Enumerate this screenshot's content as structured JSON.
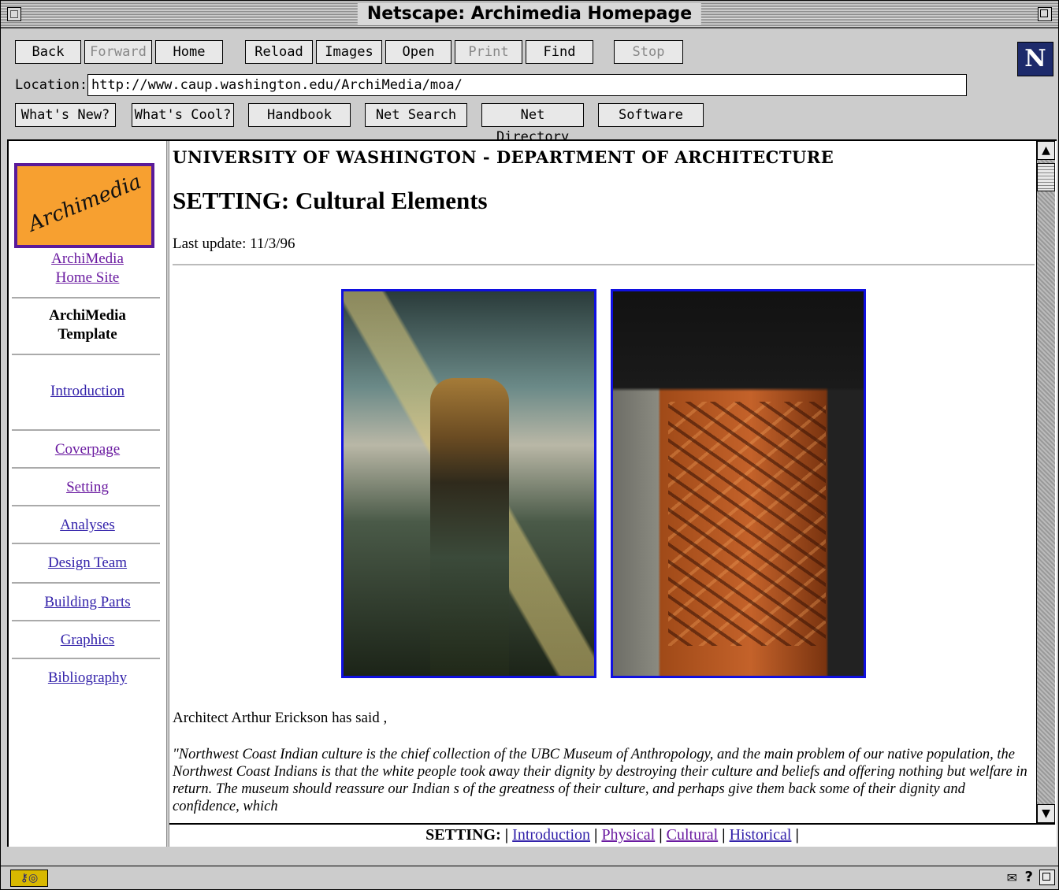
{
  "window": {
    "title": "Netscape: Archimedia Homepage"
  },
  "toolbar": {
    "buttons": [
      {
        "label": "Back",
        "enabled": true
      },
      {
        "label": "Forward",
        "enabled": false
      },
      {
        "label": "Home",
        "enabled": true
      },
      {
        "label": "Reload",
        "enabled": true
      },
      {
        "label": "Images",
        "enabled": true
      },
      {
        "label": "Open",
        "enabled": true
      },
      {
        "label": "Print",
        "enabled": false
      },
      {
        "label": "Find",
        "enabled": true
      },
      {
        "label": "Stop",
        "enabled": false
      }
    ],
    "logo_letter": "N"
  },
  "location": {
    "label": "Location:",
    "url": "http://www.caup.washington.edu/ArchiMedia/moa/"
  },
  "directory": {
    "buttons": [
      "What's New?",
      "What's Cool?",
      "Handbook",
      "Net Search",
      "Net Directory",
      "Software"
    ]
  },
  "sidebar": {
    "logo_text": "Archimedia",
    "home_link_line1": "ArchiMedia",
    "home_link_line2": "Home Site",
    "template_line1": "ArchiMedia",
    "template_line2": "Template",
    "items": [
      {
        "label": "Introduction",
        "visited": false
      },
      {
        "label": "Coverpage",
        "visited": true
      },
      {
        "label": "Setting",
        "visited": true
      },
      {
        "label": "Analyses",
        "visited": false
      },
      {
        "label": "Design Team",
        "visited": false
      },
      {
        "label": "Building Parts",
        "visited": false
      },
      {
        "label": "Graphics",
        "visited": false
      },
      {
        "label": "Bibliography",
        "visited": false
      }
    ]
  },
  "main": {
    "header": "UNIVERSITY OF WASHINGTON - DEPARTMENT OF ARCHITECTURE",
    "title": "SETTING: Cultural Elements",
    "last_update": "Last update: 11/3/96",
    "intro": "Architect Arthur Erickson has said ,",
    "quote": "\"Northwest Coast Indian culture is the chief collection of the UBC Museum of Anthropology, and the main problem of our native population, the Northwest Coast Indians is that the white people took away their dignity by destroying their culture and beliefs and offering nothing but welfare in return.  The museum should reassure our Indian s of the greatness of their culture, and perhaps give them back some of their dignity and confidence,  which"
  },
  "bottom_nav": {
    "label": "SETTING",
    "links": [
      {
        "label": "Introduction",
        "visited": false
      },
      {
        "label": "Physical",
        "visited": true
      },
      {
        "label": "Cultural",
        "visited": true
      },
      {
        "label": "Historical",
        "visited": false
      }
    ]
  },
  "colors": {
    "link": "#3322aa",
    "visited": "#6a1aa0",
    "photo_border": "#1010e0",
    "logo_bg": "#f7a030"
  }
}
